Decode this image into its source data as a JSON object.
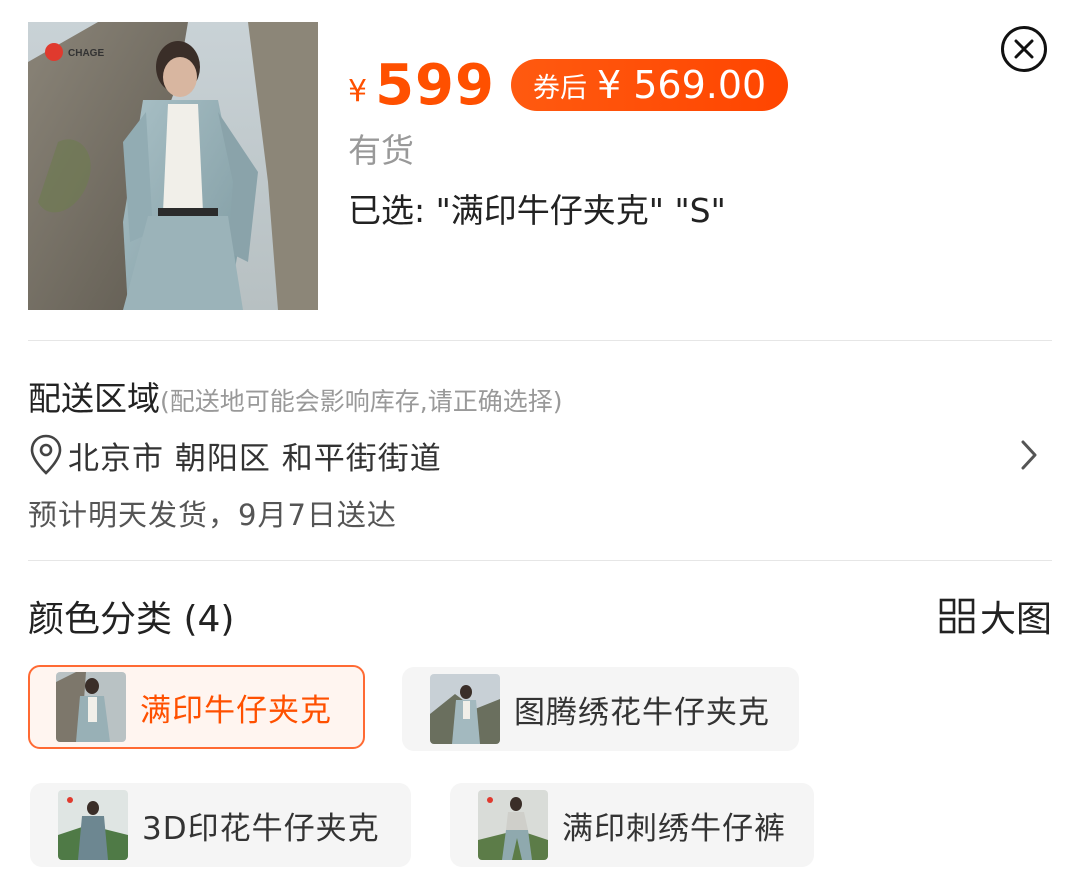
{
  "product": {
    "brand_logo_text": "CHAGE",
    "price_symbol": "¥",
    "price": "599",
    "coupon_tag": "券后",
    "coupon_price": "¥ 569.00",
    "stock_status": "有货",
    "selected_text": "已选: \"满印牛仔夹克\" \"S\""
  },
  "delivery": {
    "title": "配送区域",
    "hint": "(配送地可能会影响库存,请正确选择)",
    "address": "北京市 朝阳区 和平街街道",
    "eta": "预计明天发货，9月7日送达"
  },
  "colors": {
    "title": "颜色分类 (4)",
    "big_image_label": "大图",
    "options": [
      {
        "label": "满印牛仔夹克",
        "selected": true
      },
      {
        "label": "图腾绣花牛仔夹克",
        "selected": false
      },
      {
        "label": "3D印花牛仔夹克",
        "selected": false
      },
      {
        "label": "满印刺绣牛仔裤",
        "selected": false
      }
    ]
  },
  "theme": {
    "accent": "#ff5000",
    "muted": "#999999"
  },
  "icons": [
    "close-icon",
    "location-pin-icon",
    "chevron-right-icon",
    "grid-view-icon"
  ]
}
